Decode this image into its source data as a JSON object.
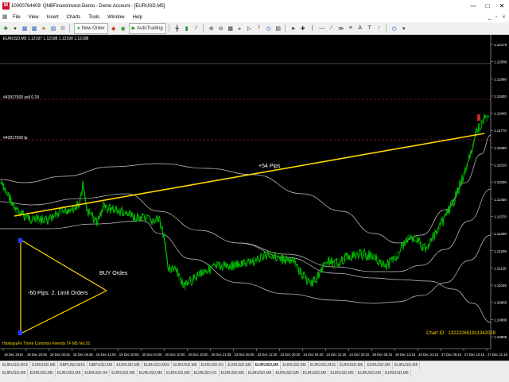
{
  "window": {
    "title": "10000764409: QNBFinansInvest-Demo - Demo Account - [EURUSD,M5]",
    "icon_name": "metatrader-app-icon",
    "minimize_glyph": "—",
    "maximize_glyph": "□",
    "close_glyph": "✕"
  },
  "menu": {
    "items": [
      "File",
      "View",
      "Insert",
      "Charts",
      "Tools",
      "Window",
      "Help"
    ],
    "right_glyphs": [
      "_",
      "▫",
      "×"
    ]
  },
  "toolbar": {
    "new_order_label": "New Order",
    "autotrading_label": "AutoTrading"
  },
  "chart": {
    "symbol_info": "EURUSD,M5  1.12197 1.12198 1.12190 1.12198",
    "level_sell_label": "#43917500 sell 0.24",
    "level_tp_label": "#43917500 tp",
    "trend_label": "+54 Pips",
    "buy_label": "BUY Ordes",
    "limit_label": "-60 Pips. 2. Limit Orders",
    "indicator_label": "HaskayaFx Three Common Friends TF M5 Ver.01",
    "chart_id_label": "Chart ID : 132222651911342028",
    "price_ticks": [
      "1.12170",
      "1.12080",
      "1.11990",
      "1.11920",
      "1.11845",
      "1.11770",
      "1.11690",
      "1.11610",
      "1.11530",
      "1.11450",
      "1.11370",
      "1.11290",
      "1.11205",
      "1.11125",
      "1.11045",
      "1.10965",
      "1.10885",
      "1.10805"
    ],
    "time_ticks": [
      "19 Dec 2019",
      "18 Dec 20:05",
      "19 Dec 00:45",
      "19 Dec 06:35",
      "19 Dec 12:00",
      "19 Dec 20:00",
      "20 Dec 04:00",
      "20 Dec 10:00",
      "20 Dec 16:00",
      "20 Dec 21:05",
      "23 Dec 05:00",
      "23 Dec 12:20",
      "23 Dec 20:20",
      "24 Dec 04:20",
      "24 Dec 12:20",
      "24 Dec 20:20",
      "26 Dec 05:15",
      "26 Dec 13:15",
      "26 Dec 21:15",
      "27 Dec 05:15",
      "27 Dec 13:15",
      "27 Dec 21:15"
    ],
    "colors": {
      "background": "#000000",
      "price": "#00c000",
      "bands": "#c8c8c8",
      "trendline": "#ffd700",
      "sell_level": "#c03030",
      "tp_level": "#c03030",
      "text": "#ffffff",
      "chart_id": "#ffd700",
      "indicator_label": "#ffd700"
    }
  },
  "tabs": {
    "row1": [
      "EURUSD,M15",
      "EURUSD,M5",
      "GBPUSD,M15",
      "GBPUSD,M5",
      "EURUSD,M5",
      "EURUSD,M15",
      "EURUSD,M5",
      "EURUSD,H1",
      "EURUSD,M5",
      "EURUSD,M5",
      "EURUSD,M5",
      "EURUSD,M15",
      "EURUSD,M5",
      "EURUSD,M5",
      "EURUSD,M5"
    ],
    "row2": [
      "EURUSD,M5",
      "EURUSD,M5",
      "EURUSD,M5",
      "EURUSD,H4",
      "EURUSD,M5",
      "EURUSD,M5",
      "EURUSD,M5",
      "EURUSD,H1",
      "EURUSD,M5",
      "EURUSD,M5",
      "EURUSD,M5",
      "EURUSD,M5",
      "EURUSD,M5",
      "EURUSD,M5",
      "EURUSD,M5"
    ]
  }
}
